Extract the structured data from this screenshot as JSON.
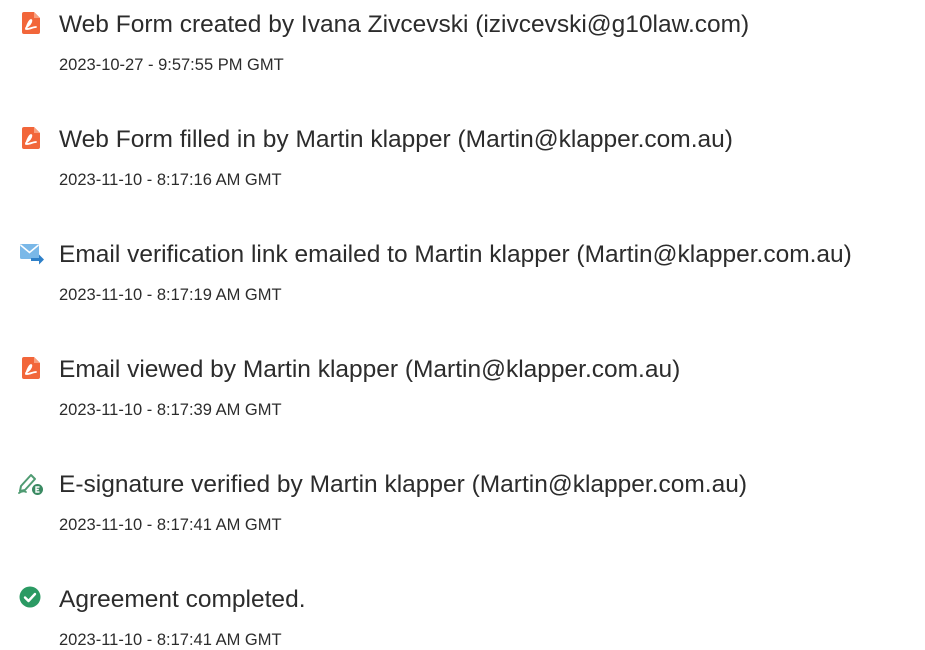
{
  "colors": {
    "pdf_icon": "#f2663a",
    "email_icon": "#7ab8e8",
    "email_arrow": "#2f80c8",
    "esign_pen": "#4f9b72",
    "esign_badge": "#3a8a62",
    "completed_check": "#2b9a63",
    "text": "#2c2c2c"
  },
  "events": [
    {
      "icon": "pdf-document-icon",
      "title": "Web Form created by Ivana Zivcevski (izivcevski@g10law.com)",
      "timestamp": "2023-10-27 - 9:57:55 PM GMT"
    },
    {
      "icon": "pdf-document-icon",
      "title": "Web Form filled in by Martin klapper (Martin@klapper.com.au)",
      "timestamp": "2023-11-10 - 8:17:16 AM GMT"
    },
    {
      "icon": "email-send-icon",
      "title": "Email verification link emailed to Martin klapper (Martin@klapper.com.au)",
      "timestamp": "2023-11-10 - 8:17:19 AM GMT"
    },
    {
      "icon": "pdf-document-icon",
      "title": "Email viewed by Martin klapper (Martin@klapper.com.au)",
      "timestamp": "2023-11-10 - 8:17:39 AM GMT"
    },
    {
      "icon": "esignature-icon",
      "title": "E-signature verified by Martin klapper (Martin@klapper.com.au)",
      "timestamp": "2023-11-10 - 8:17:41 AM GMT"
    },
    {
      "icon": "check-circle-icon",
      "title": "Agreement completed.",
      "timestamp": "2023-11-10 - 8:17:41 AM GMT"
    }
  ]
}
